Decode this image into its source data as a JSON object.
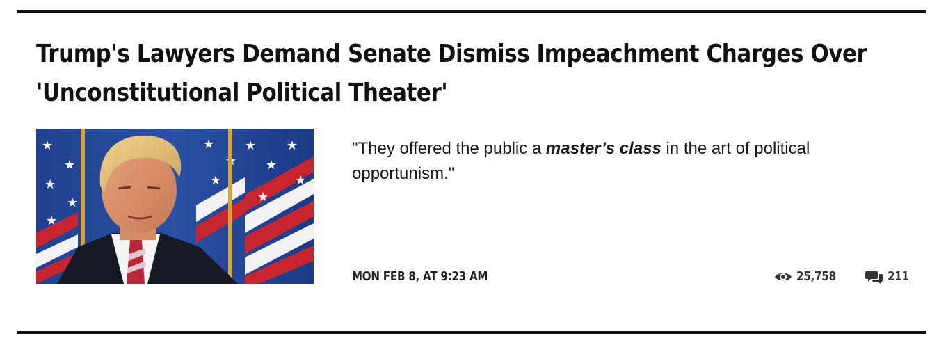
{
  "article": {
    "headline_line1": "Trump's Lawyers Demand Senate Dismiss Impeachment Charges Over",
    "headline_line2": "'Unconstitutional Political Theater'",
    "thumbnail_icon": "photo-thumbnail",
    "excerpt": {
      "before": "\"They offered the public a ",
      "emphasis": "master’s class",
      "after": " in the art of political opportunism.\""
    },
    "date": "MON FEB 8, AT 9:23 AM",
    "views": {
      "icon": "eye-icon",
      "count": "25,758"
    },
    "comments": {
      "icon": "comments-icon",
      "count": "211"
    }
  },
  "colors": {
    "text": "#111111",
    "rule": "#111111",
    "meta": "#333333",
    "background": "#ffffff"
  }
}
